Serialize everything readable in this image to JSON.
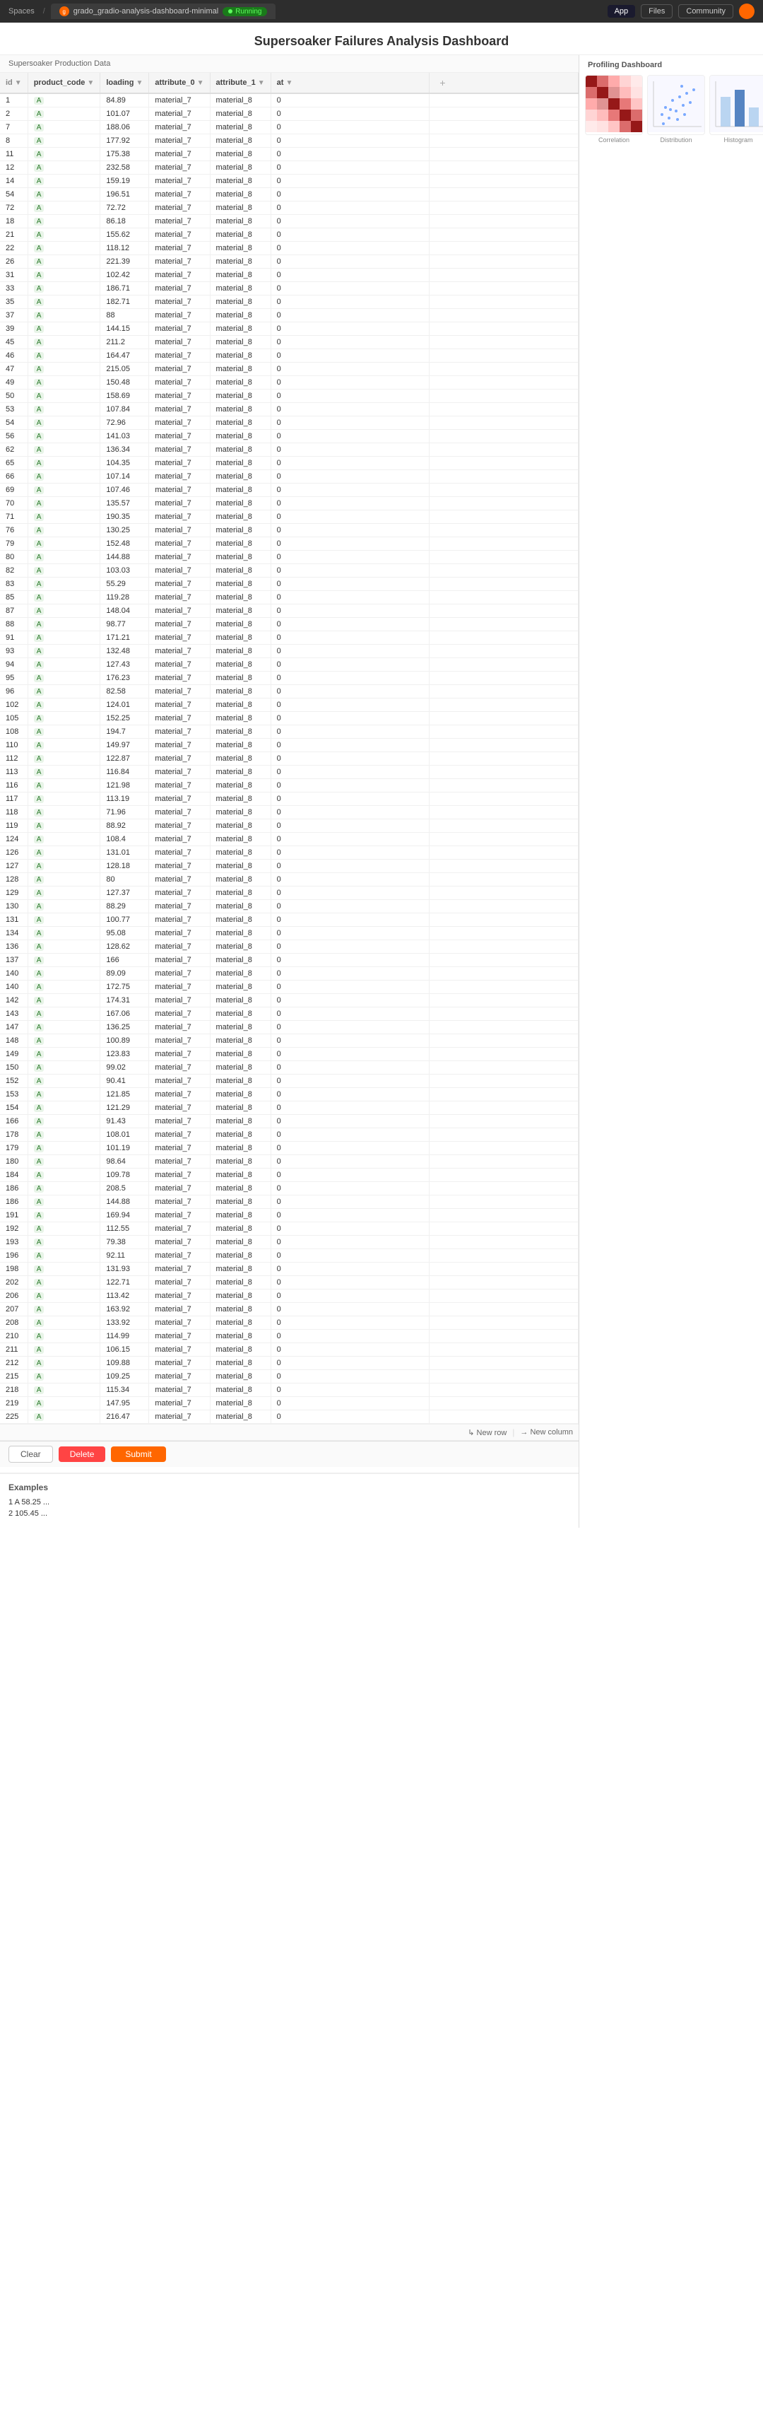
{
  "browser": {
    "spaces_label": "Spaces",
    "tab_label": "grado_gradio-analysis-dashboard-minimal",
    "running_label": "Running",
    "btn_app": "App",
    "btn_files": "Files",
    "btn_community": "Community"
  },
  "page": {
    "title": "Supersoaker Failures Analysis Dashboard"
  },
  "left_panel": {
    "header": "Supersoaker Production Data"
  },
  "right_panel": {
    "header": "Profiling Dashboard"
  },
  "table": {
    "columns": [
      "id",
      "product_code",
      "loading",
      "attribute_0",
      "attribute_1",
      "at"
    ],
    "rows": [
      [
        "1",
        "A",
        "84.89",
        "material_7",
        "material_8",
        "0"
      ],
      [
        "2",
        "A",
        "101.07",
        "material_7",
        "material_8",
        "0"
      ],
      [
        "7",
        "A",
        "188.06",
        "material_7",
        "material_8",
        "0"
      ],
      [
        "8",
        "A",
        "177.92",
        "material_7",
        "material_8",
        "0"
      ],
      [
        "11",
        "A",
        "175.38",
        "material_7",
        "material_8",
        "0"
      ],
      [
        "12",
        "A",
        "232.58",
        "material_7",
        "material_8",
        "0"
      ],
      [
        "14",
        "A",
        "159.19",
        "material_7",
        "material_8",
        "0"
      ],
      [
        "54",
        "A",
        "196.51",
        "material_7",
        "material_8",
        "0"
      ],
      [
        "72",
        "A",
        "72.72",
        "material_7",
        "material_8",
        "0"
      ],
      [
        "18",
        "A",
        "86.18",
        "material_7",
        "material_8",
        "0"
      ],
      [
        "21",
        "A",
        "155.62",
        "material_7",
        "material_8",
        "0"
      ],
      [
        "22",
        "A",
        "118.12",
        "material_7",
        "material_8",
        "0"
      ],
      [
        "26",
        "A",
        "221.39",
        "material_7",
        "material_8",
        "0"
      ],
      [
        "31",
        "A",
        "102.42",
        "material_7",
        "material_8",
        "0"
      ],
      [
        "33",
        "A",
        "186.71",
        "material_7",
        "material_8",
        "0"
      ],
      [
        "35",
        "A",
        "182.71",
        "material_7",
        "material_8",
        "0"
      ],
      [
        "37",
        "A",
        "88",
        "material_7",
        "material_8",
        "0"
      ],
      [
        "39",
        "A",
        "144.15",
        "material_7",
        "material_8",
        "0"
      ],
      [
        "45",
        "A",
        "211.2",
        "material_7",
        "material_8",
        "0"
      ],
      [
        "46",
        "A",
        "164.47",
        "material_7",
        "material_8",
        "0"
      ],
      [
        "47",
        "A",
        "215.05",
        "material_7",
        "material_8",
        "0"
      ],
      [
        "49",
        "A",
        "150.48",
        "material_7",
        "material_8",
        "0"
      ],
      [
        "50",
        "A",
        "158.69",
        "material_7",
        "material_8",
        "0"
      ],
      [
        "53",
        "A",
        "107.84",
        "material_7",
        "material_8",
        "0"
      ],
      [
        "54",
        "A",
        "72.96",
        "material_7",
        "material_8",
        "0"
      ],
      [
        "56",
        "A",
        "141.03",
        "material_7",
        "material_8",
        "0"
      ],
      [
        "62",
        "A",
        "136.34",
        "material_7",
        "material_8",
        "0"
      ],
      [
        "65",
        "A",
        "104.35",
        "material_7",
        "material_8",
        "0"
      ],
      [
        "66",
        "A",
        "107.14",
        "material_7",
        "material_8",
        "0"
      ],
      [
        "69",
        "A",
        "107.46",
        "material_7",
        "material_8",
        "0"
      ],
      [
        "70",
        "A",
        "135.57",
        "material_7",
        "material_8",
        "0"
      ],
      [
        "71",
        "A",
        "190.35",
        "material_7",
        "material_8",
        "0"
      ],
      [
        "76",
        "A",
        "130.25",
        "material_7",
        "material_8",
        "0"
      ],
      [
        "79",
        "A",
        "152.48",
        "material_7",
        "material_8",
        "0"
      ],
      [
        "80",
        "A",
        "144.88",
        "material_7",
        "material_8",
        "0"
      ],
      [
        "82",
        "A",
        "103.03",
        "material_7",
        "material_8",
        "0"
      ],
      [
        "83",
        "A",
        "55.29",
        "material_7",
        "material_8",
        "0"
      ],
      [
        "85",
        "A",
        "119.28",
        "material_7",
        "material_8",
        "0"
      ],
      [
        "87",
        "A",
        "148.04",
        "material_7",
        "material_8",
        "0"
      ],
      [
        "88",
        "A",
        "98.77",
        "material_7",
        "material_8",
        "0"
      ],
      [
        "91",
        "A",
        "171.21",
        "material_7",
        "material_8",
        "0"
      ],
      [
        "93",
        "A",
        "132.48",
        "material_7",
        "material_8",
        "0"
      ],
      [
        "94",
        "A",
        "127.43",
        "material_7",
        "material_8",
        "0"
      ],
      [
        "95",
        "A",
        "176.23",
        "material_7",
        "material_8",
        "0"
      ],
      [
        "96",
        "A",
        "82.58",
        "material_7",
        "material_8",
        "0"
      ],
      [
        "102",
        "A",
        "124.01",
        "material_7",
        "material_8",
        "0"
      ],
      [
        "105",
        "A",
        "152.25",
        "material_7",
        "material_8",
        "0"
      ],
      [
        "108",
        "A",
        "194.7",
        "material_7",
        "material_8",
        "0"
      ],
      [
        "110",
        "A",
        "149.97",
        "material_7",
        "material_8",
        "0"
      ],
      [
        "112",
        "A",
        "122.87",
        "material_7",
        "material_8",
        "0"
      ],
      [
        "113",
        "A",
        "116.84",
        "material_7",
        "material_8",
        "0"
      ],
      [
        "116",
        "A",
        "121.98",
        "material_7",
        "material_8",
        "0"
      ],
      [
        "117",
        "A",
        "113.19",
        "material_7",
        "material_8",
        "0"
      ],
      [
        "118",
        "A",
        "71.96",
        "material_7",
        "material_8",
        "0"
      ],
      [
        "119",
        "A",
        "88.92",
        "material_7",
        "material_8",
        "0"
      ],
      [
        "124",
        "A",
        "108.4",
        "material_7",
        "material_8",
        "0"
      ],
      [
        "126",
        "A",
        "131.01",
        "material_7",
        "material_8",
        "0"
      ],
      [
        "127",
        "A",
        "128.18",
        "material_7",
        "material_8",
        "0"
      ],
      [
        "128",
        "A",
        "80",
        "material_7",
        "material_8",
        "0"
      ],
      [
        "129",
        "A",
        "127.37",
        "material_7",
        "material_8",
        "0"
      ],
      [
        "130",
        "A",
        "88.29",
        "material_7",
        "material_8",
        "0"
      ],
      [
        "131",
        "A",
        "100.77",
        "material_7",
        "material_8",
        "0"
      ],
      [
        "134",
        "A",
        "95.08",
        "material_7",
        "material_8",
        "0"
      ],
      [
        "136",
        "A",
        "128.62",
        "material_7",
        "material_8",
        "0"
      ],
      [
        "137",
        "A",
        "166",
        "material_7",
        "material_8",
        "0"
      ],
      [
        "140",
        "A",
        "89.09",
        "material_7",
        "material_8",
        "0"
      ],
      [
        "140",
        "A",
        "172.75",
        "material_7",
        "material_8",
        "0"
      ],
      [
        "142",
        "A",
        "174.31",
        "material_7",
        "material_8",
        "0"
      ],
      [
        "143",
        "A",
        "167.06",
        "material_7",
        "material_8",
        "0"
      ],
      [
        "147",
        "A",
        "136.25",
        "material_7",
        "material_8",
        "0"
      ],
      [
        "148",
        "A",
        "100.89",
        "material_7",
        "material_8",
        "0"
      ],
      [
        "149",
        "A",
        "123.83",
        "material_7",
        "material_8",
        "0"
      ],
      [
        "150",
        "A",
        "99.02",
        "material_7",
        "material_8",
        "0"
      ],
      [
        "152",
        "A",
        "90.41",
        "material_7",
        "material_8",
        "0"
      ],
      [
        "153",
        "A",
        "121.85",
        "material_7",
        "material_8",
        "0"
      ],
      [
        "154",
        "A",
        "121.29",
        "material_7",
        "material_8",
        "0"
      ],
      [
        "166",
        "A",
        "91.43",
        "material_7",
        "material_8",
        "0"
      ],
      [
        "178",
        "A",
        "108.01",
        "material_7",
        "material_8",
        "0"
      ],
      [
        "179",
        "A",
        "101.19",
        "material_7",
        "material_8",
        "0"
      ],
      [
        "180",
        "A",
        "98.64",
        "material_7",
        "material_8",
        "0"
      ],
      [
        "184",
        "A",
        "109.78",
        "material_7",
        "material_8",
        "0"
      ],
      [
        "186",
        "A",
        "208.5",
        "material_7",
        "material_8",
        "0"
      ],
      [
        "186",
        "A",
        "144.88",
        "material_7",
        "material_8",
        "0"
      ],
      [
        "191",
        "A",
        "169.94",
        "material_7",
        "material_8",
        "0"
      ],
      [
        "192",
        "A",
        "112.55",
        "material_7",
        "material_8",
        "0"
      ],
      [
        "193",
        "A",
        "79.38",
        "material_7",
        "material_8",
        "0"
      ],
      [
        "196",
        "A",
        "92.11",
        "material_7",
        "material_8",
        "0"
      ],
      [
        "198",
        "A",
        "131.93",
        "material_7",
        "material_8",
        "0"
      ],
      [
        "202",
        "A",
        "122.71",
        "material_7",
        "material_8",
        "0"
      ],
      [
        "206",
        "A",
        "113.42",
        "material_7",
        "material_8",
        "0"
      ],
      [
        "207",
        "A",
        "163.92",
        "material_7",
        "material_8",
        "0"
      ],
      [
        "208",
        "A",
        "133.92",
        "material_7",
        "material_8",
        "0"
      ],
      [
        "210",
        "A",
        "114.99",
        "material_7",
        "material_8",
        "0"
      ],
      [
        "211",
        "A",
        "106.15",
        "material_7",
        "material_8",
        "0"
      ],
      [
        "212",
        "A",
        "109.88",
        "material_7",
        "material_8",
        "0"
      ],
      [
        "215",
        "A",
        "109.25",
        "material_7",
        "material_8",
        "0"
      ],
      [
        "218",
        "A",
        "115.34",
        "material_7",
        "material_8",
        "0"
      ],
      [
        "219",
        "A",
        "147.95",
        "material_7",
        "material_8",
        "0"
      ],
      [
        "225",
        "A",
        "216.47",
        "material_7",
        "material_8",
        "0"
      ]
    ]
  },
  "toolbar": {
    "new_row_label": "↳ New row",
    "new_col_label": "→ New column",
    "clear_label": "Clear",
    "delete_label": "Delete",
    "submit_label": "Submit"
  },
  "examples": {
    "label": "Examples",
    "items": [
      "1  A  58.25  ...",
      "2  105.45  ..."
    ]
  }
}
